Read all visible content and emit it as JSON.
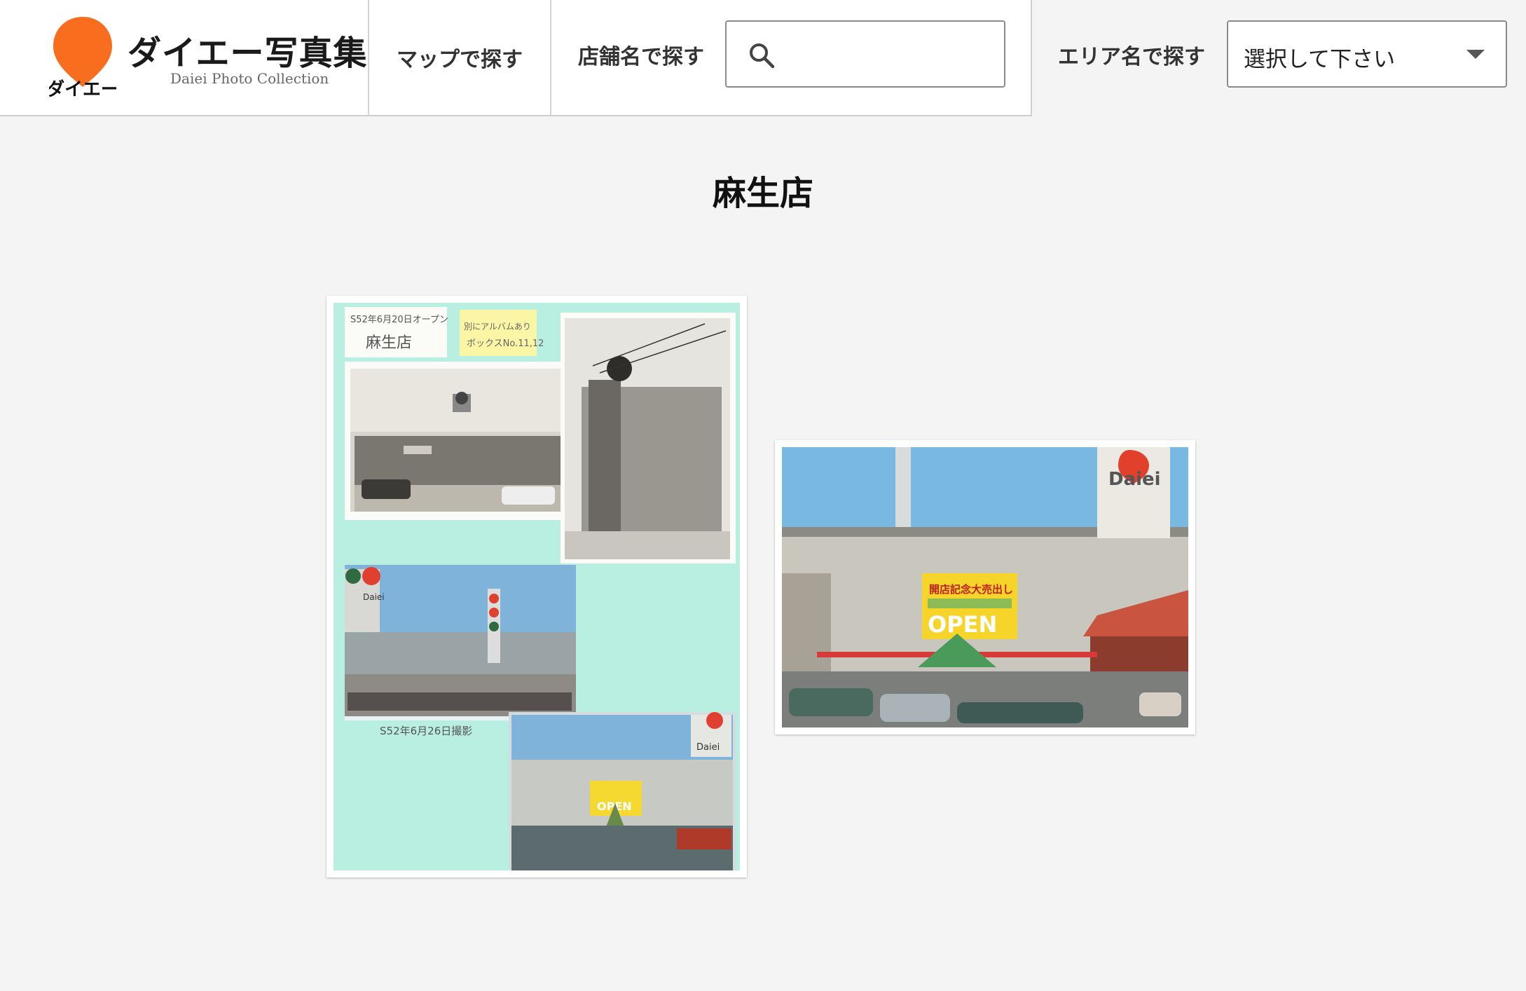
{
  "brand": {
    "logo_mark_text": "ダイエー",
    "title": "ダイエー写真集",
    "subtitle": "Daiei Photo Collection"
  },
  "nav": {
    "map_label": "マップで探す",
    "store_label": "店舗名で探す",
    "area_label": "エリア名で探す"
  },
  "search": {
    "placeholder": "",
    "value": ""
  },
  "area_select": {
    "selected": "選択して下さい"
  },
  "page": {
    "title": "麻生店"
  },
  "photos": [
    {
      "note_1": "S52年6月20日オープン",
      "note_1b": "麻生店",
      "note_2": "別にアルバムあり",
      "note_2b": "ボックスNo.11,12",
      "caption": "S52年6月26日撮影",
      "sign_1": "Daiei",
      "sign_2": "OPEN"
    },
    {
      "sign_1": "Daiei",
      "banner": "開店記念大売出し",
      "sign_2": "OPEN"
    }
  ],
  "colors": {
    "brand_orange": "#f86e1e",
    "album_bg": "#b9efe1",
    "page_bg": "#f4f4f4"
  }
}
